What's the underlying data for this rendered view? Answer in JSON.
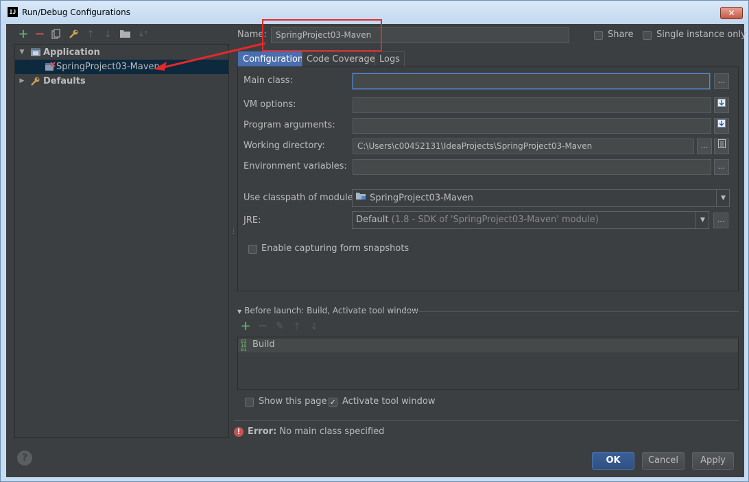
{
  "window": {
    "title": "Run/Debug Configurations",
    "app_icon": "IJ",
    "close_glyph": "✕"
  },
  "toolbar": {
    "icons": [
      "add-icon",
      "remove-icon",
      "copy-icon",
      "wrench-icon",
      "move-up-icon",
      "move-down-icon",
      "folder-icon",
      "sort-icon"
    ]
  },
  "tree": {
    "application_label": "Application",
    "config_label": "SpringProject03-Maven",
    "defaults_label": "Defaults"
  },
  "header": {
    "name_label": "Name:",
    "name_value": "SpringProject03-Maven",
    "share_label": "Share",
    "single_instance_label": "Single instance only"
  },
  "tabs": [
    "Configuration",
    "Code Coverage",
    "Logs"
  ],
  "form": {
    "main_class_label": "Main class:",
    "main_class_value": "",
    "vm_options_label": "VM options:",
    "program_args_label": "Program arguments:",
    "working_dir_label": "Working directory:",
    "working_dir_value": "C:\\Users\\c00452131\\IdeaProjects\\SpringProject03-Maven",
    "env_vars_label": "Environment variables:",
    "classpath_label": "Use classpath of module:",
    "classpath_value": "SpringProject03-Maven",
    "jre_label": "JRE:",
    "jre_value_main": "Default",
    "jre_value_detail": "(1.8 - SDK of 'SpringProject03-Maven' module)",
    "snapshots_label": "Enable capturing form snapshots",
    "ellipsis": "..."
  },
  "before_launch": {
    "title": "Before launch: Build, Activate tool window",
    "items": [
      "Build"
    ],
    "show_page_label": "Show this page",
    "activate_label": "Activate tool window"
  },
  "status": {
    "error_prefix": "Error:",
    "error_message": "No main class specified"
  },
  "buttons": {
    "ok": "OK",
    "cancel": "Cancel",
    "apply": "Apply",
    "help": "?"
  },
  "colors": {
    "background": "#3c3f41",
    "selection": "#0d293e",
    "tab_active": "#4b6eaf",
    "annotation_red": "#e3292a",
    "add_green": "#59a869",
    "remove_red": "#c75450"
  }
}
